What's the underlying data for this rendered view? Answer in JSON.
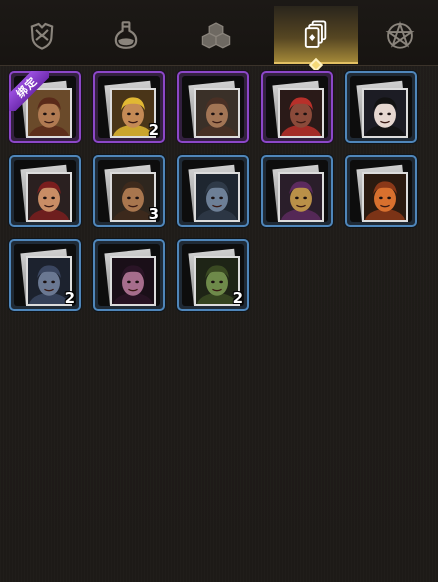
{
  "tabs": [
    {
      "id": "armor",
      "icon": "armor-icon",
      "active": false
    },
    {
      "id": "potion",
      "icon": "potion-icon",
      "active": false
    },
    {
      "id": "materials",
      "icon": "cubes-icon",
      "active": false
    },
    {
      "id": "cards",
      "icon": "cards-icon",
      "active": true
    },
    {
      "id": "emblem",
      "icon": "pentagram-icon",
      "active": false
    }
  ],
  "cards": [
    {
      "name": "card-bandana-gunner",
      "rarity": "purple",
      "count": "",
      "badge": "绑定",
      "skin": "#b07a52",
      "hair": "#5a2a1a",
      "bg": "#6a4a2a"
    },
    {
      "name": "card-blonde-fighter",
      "rarity": "purple",
      "count": "2",
      "badge": "",
      "skin": "#c48a55",
      "hair": "#e1b833",
      "bg": "#4a3518"
    },
    {
      "name": "card-horned-brute",
      "rarity": "purple",
      "count": "",
      "badge": "",
      "skin": "#a27555",
      "hair": "#4a3025",
      "bg": "#3a3028"
    },
    {
      "name": "card-red-hair-mage",
      "rarity": "purple",
      "count": "",
      "badge": "",
      "skin": "#8a4a3a",
      "hair": "#b8302a",
      "bg": "#2a1a18"
    },
    {
      "name": "card-dark-hair-girl",
      "rarity": "blue",
      "count": "",
      "badge": "",
      "skin": "#e6d7d0",
      "hair": "#121212",
      "bg": "#1c1c24"
    },
    {
      "name": "card-hooded-rogue",
      "rarity": "blue",
      "count": "",
      "badge": "",
      "skin": "#c98d65",
      "hair": "#7a1e1e",
      "bg": "#2a2020"
    },
    {
      "name": "card-roaring-ogre",
      "rarity": "blue",
      "count": "3",
      "badge": "",
      "skin": "#a8764e",
      "hair": "#3e2a1c",
      "bg": "#2e261e"
    },
    {
      "name": "card-armored-knight",
      "rarity": "blue",
      "count": "",
      "badge": "",
      "skin": "#6d7f96",
      "hair": "#2f3a48",
      "bg": "#1e2630"
    },
    {
      "name": "card-golden-barrel",
      "rarity": "blue",
      "count": "",
      "badge": "",
      "skin": "#b99048",
      "hair": "#5c2a5e",
      "bg": "#2a1e2a"
    },
    {
      "name": "card-fire-dragon",
      "rarity": "blue",
      "count": "",
      "badge": "",
      "skin": "#d8702e",
      "hair": "#8a3818",
      "bg": "#2a1a10"
    },
    {
      "name": "card-blue-beast",
      "rarity": "blue",
      "count": "2",
      "badge": "",
      "skin": "#6a7892",
      "hair": "#3a4660",
      "bg": "#1c222e"
    },
    {
      "name": "card-shadow-witch",
      "rarity": "blue",
      "count": "",
      "badge": "",
      "skin": "#a66d8c",
      "hair": "#2a1426",
      "bg": "#1a0f18"
    },
    {
      "name": "card-green-goblin",
      "rarity": "blue",
      "count": "2",
      "badge": "",
      "skin": "#6e8a4a",
      "hair": "#3a4a22",
      "bg": "#1e2416"
    }
  ]
}
